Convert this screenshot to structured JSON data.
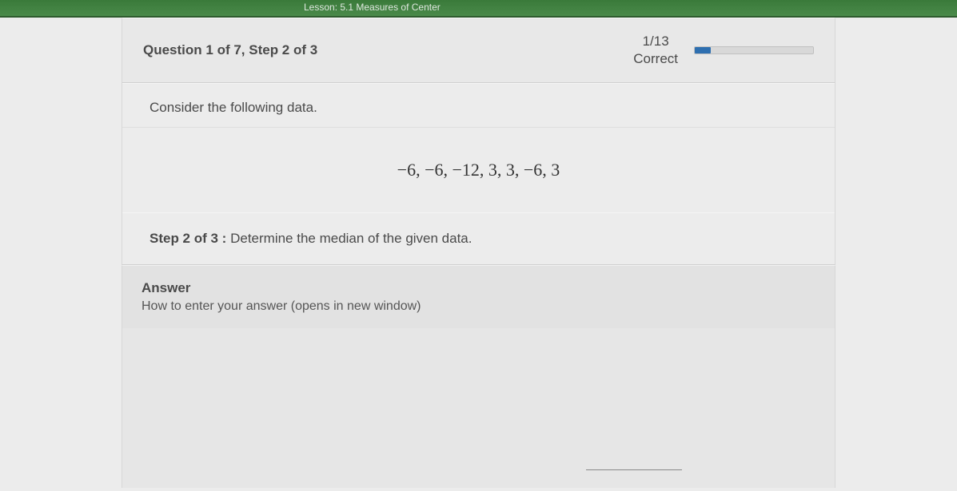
{
  "topbar": {
    "lesson_text": "Lesson: 5.1 Measures of Center"
  },
  "header": {
    "title": "Question 1 of 7, Step 2 of 3",
    "score_fraction": "1/13",
    "score_label": "Correct"
  },
  "content": {
    "consider": "Consider the following data.",
    "data_values": "−6, −6, −12, 3, 3, −6, 3",
    "step_label": "Step 2 of 3 :",
    "step_instruction": " Determine the median of the given data."
  },
  "answer": {
    "heading": "Answer",
    "help_text": "How to enter your answer (opens in new window)",
    "input_value": ""
  }
}
